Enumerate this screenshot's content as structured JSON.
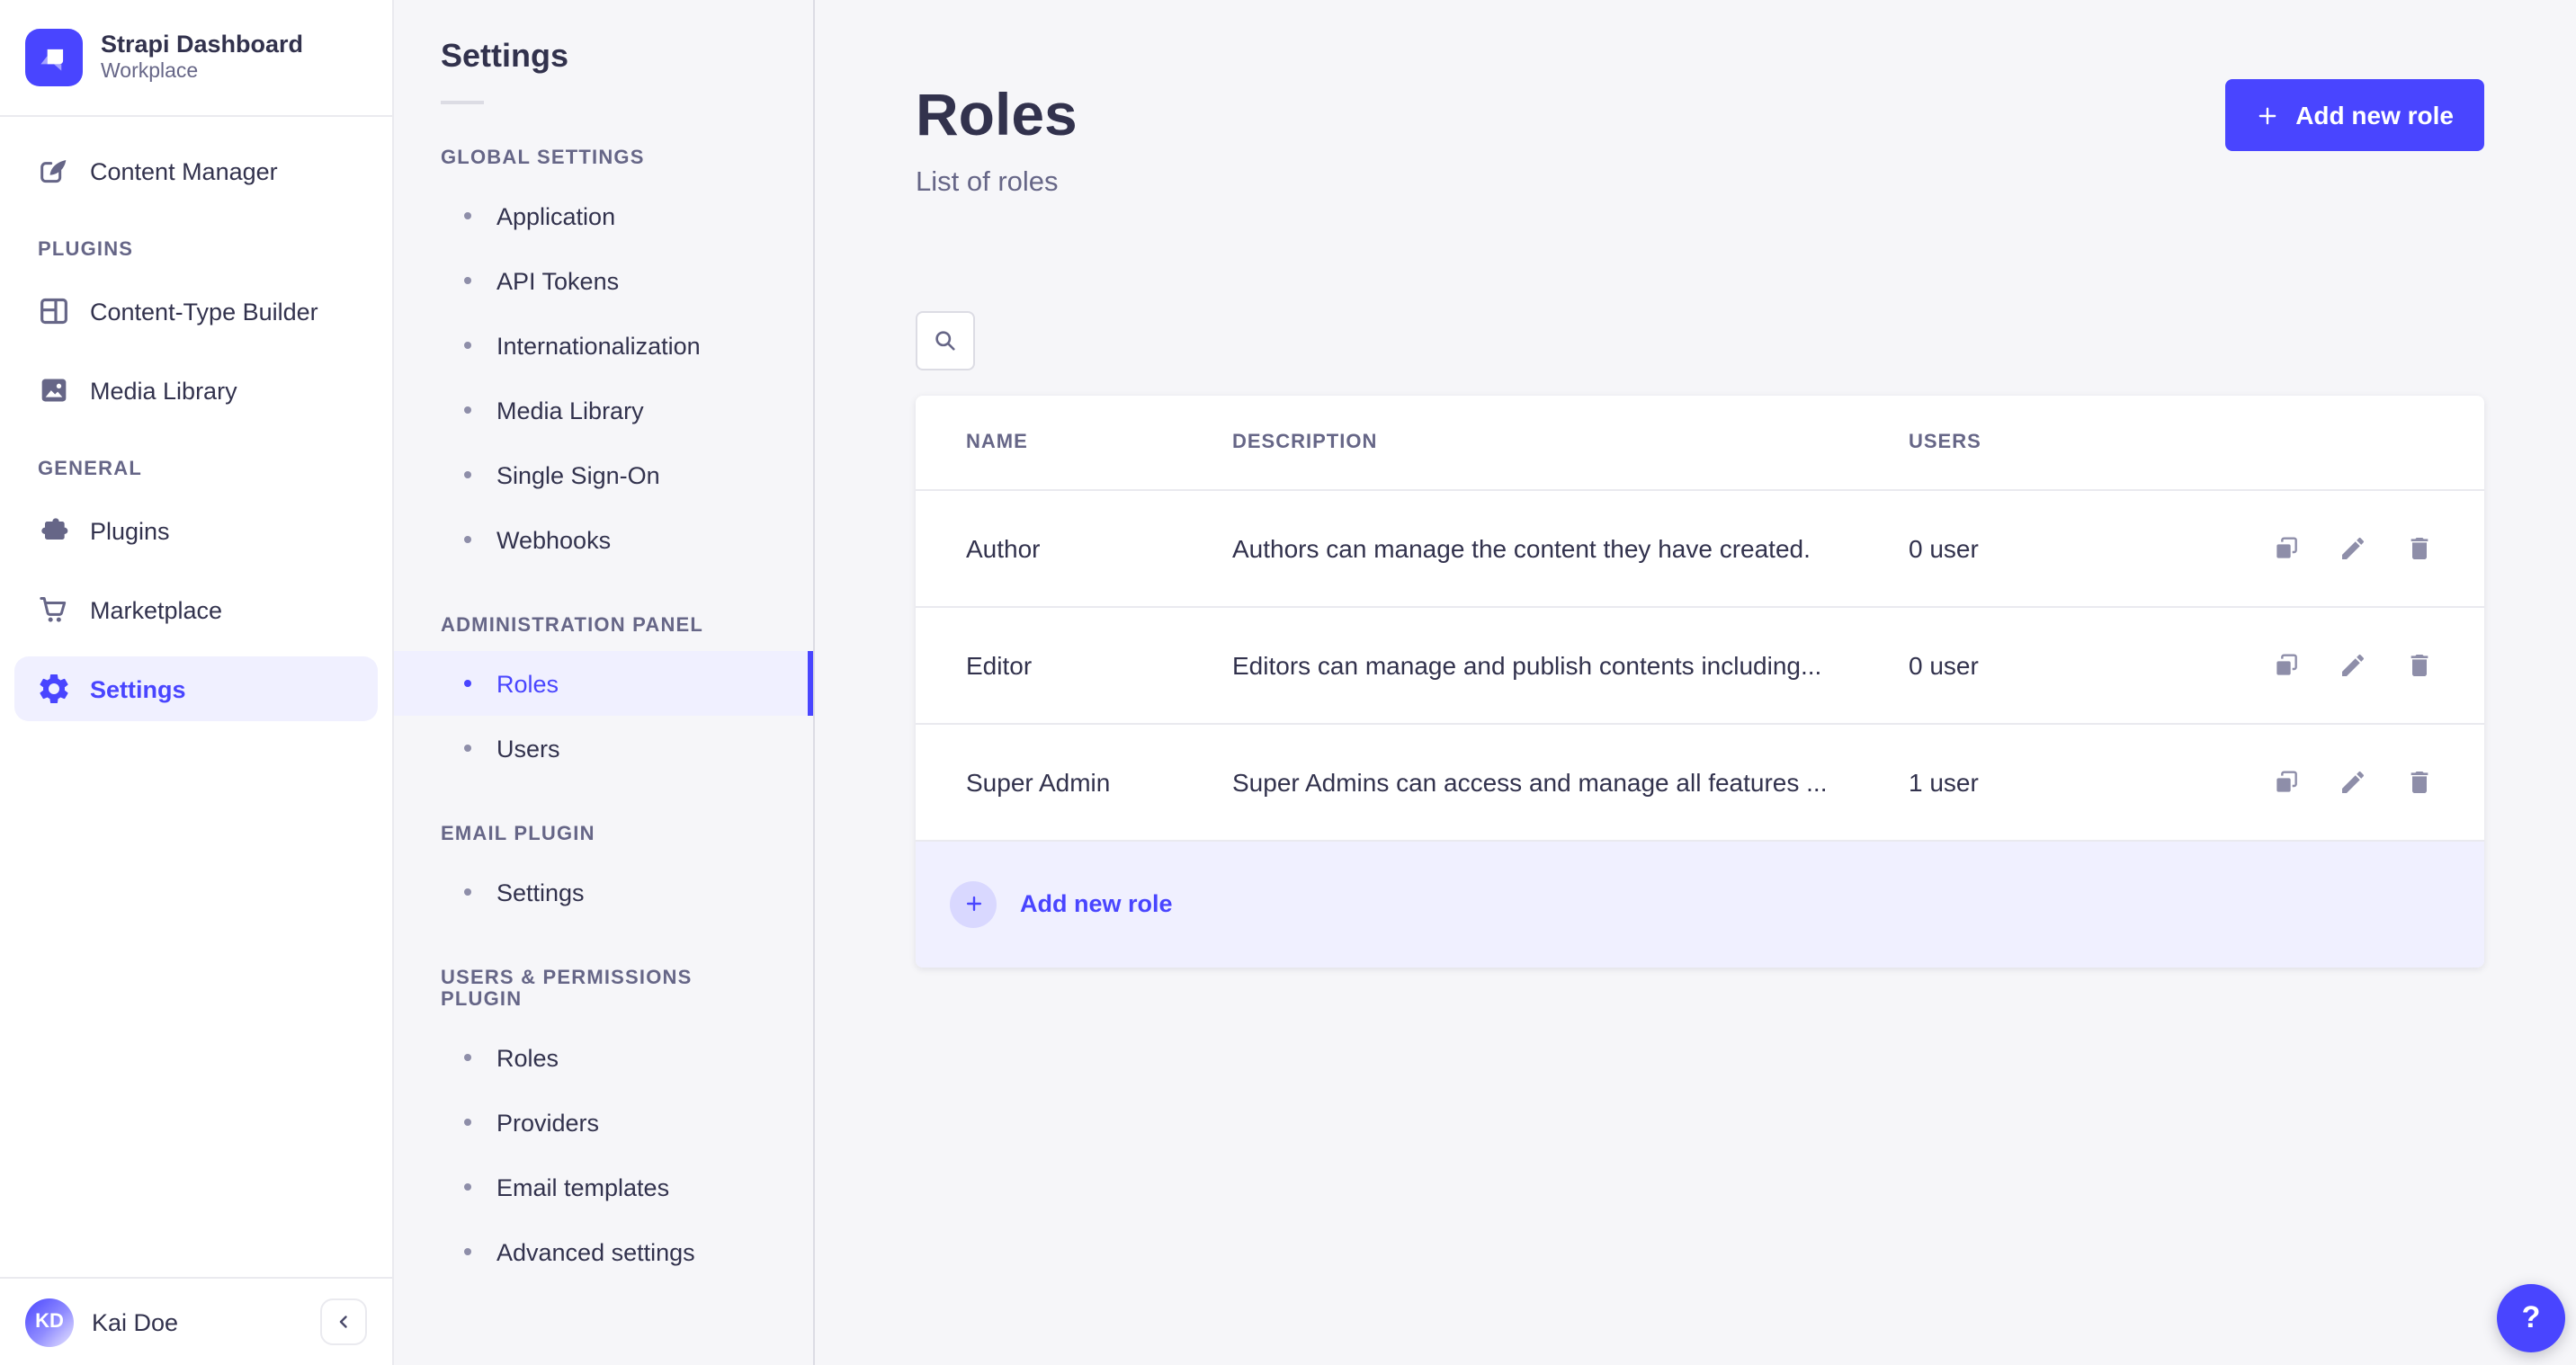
{
  "app": {
    "brand": {
      "title": "Strapi Dashboard",
      "subtitle": "Workplace"
    },
    "colors": {
      "primary": "#4945ff",
      "primary_light_bg": "#f0f0ff",
      "text": "#32324d",
      "muted": "#666687",
      "icon_gray": "#8e8ea9",
      "border": "#eaeaef",
      "page_bg": "#f6f6f9"
    }
  },
  "sidebar": {
    "content_manager": {
      "label": "Content Manager",
      "icon": "feather-icon"
    },
    "sections": [
      {
        "header": "PLUGINS",
        "items": [
          {
            "label": "Content-Type Builder",
            "icon": "layout-grid-icon"
          },
          {
            "label": "Media Library",
            "icon": "picture-icon"
          }
        ]
      },
      {
        "header": "GENERAL",
        "items": [
          {
            "label": "Plugins",
            "icon": "puzzle-icon"
          },
          {
            "label": "Marketplace",
            "icon": "cart-icon"
          },
          {
            "label": "Settings",
            "icon": "gear-icon",
            "active": true
          }
        ]
      }
    ],
    "user": {
      "initials": "KD",
      "name": "Kai Doe"
    },
    "collapse_icon": "chevron-left-icon"
  },
  "subnav": {
    "title": "Settings",
    "sections": [
      {
        "header": "GLOBAL SETTINGS",
        "items": [
          "Application",
          "API Tokens",
          "Internationalization",
          "Media Library",
          "Single Sign-On",
          "Webhooks"
        ]
      },
      {
        "header": "ADMINISTRATION PANEL",
        "items": [
          "Roles",
          "Users"
        ],
        "active_item": "Roles"
      },
      {
        "header": "EMAIL PLUGIN",
        "items": [
          "Settings"
        ]
      },
      {
        "header": "USERS & PERMISSIONS PLUGIN",
        "items": [
          "Roles",
          "Providers",
          "Email templates",
          "Advanced settings"
        ]
      }
    ]
  },
  "main": {
    "page_title": "Roles",
    "page_subtitle": "List of roles",
    "add_role_button": "Add new role",
    "search_icon": "magnifier-icon",
    "table": {
      "headers": [
        "NAME",
        "DESCRIPTION",
        "USERS"
      ],
      "rows": [
        {
          "name": "Author",
          "description": "Authors can manage the content they have created.",
          "users": "0 user"
        },
        {
          "name": "Editor",
          "description": "Editors can manage and publish contents including...",
          "users": "0 user"
        },
        {
          "name": "Super Admin",
          "description": "Super Admins can access and manage all features ...",
          "users": "1 user"
        }
      ],
      "row_actions": [
        "duplicate",
        "edit",
        "delete"
      ],
      "footer_add_label": "Add new role"
    },
    "help_button": "?"
  }
}
